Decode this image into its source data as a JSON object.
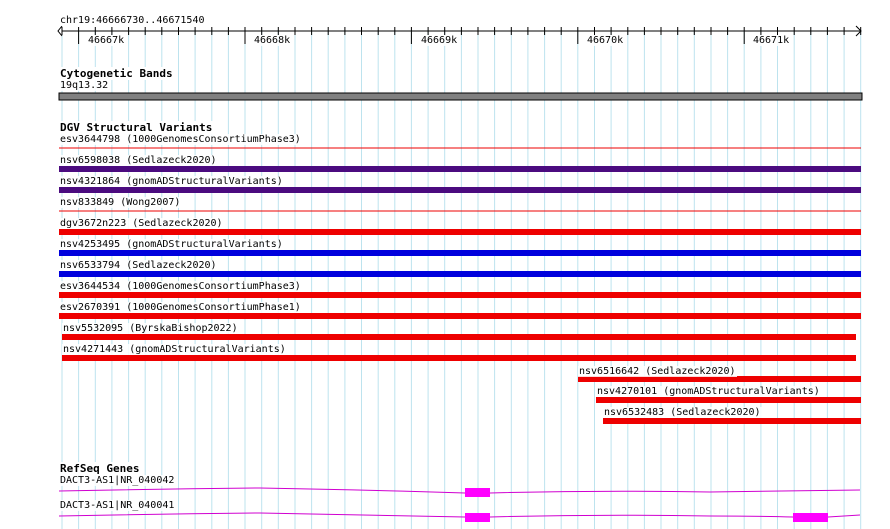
{
  "ruler": {
    "location": "chr19:46666730..46671540",
    "ticks": [
      "46667k",
      "46668k",
      "46669k",
      "46670k",
      "46671k"
    ]
  },
  "cytoband": {
    "title": "Cytogenetic Bands",
    "band": "19q13.32",
    "color": "#808080"
  },
  "dgv": {
    "title": "DGV Structural Variants",
    "colors": {
      "red": "#ee0000",
      "blue": "#0000dd",
      "purple": "#4b0b7f"
    },
    "features": [
      {
        "label": "esv3644798 (1000GenomesConsortiumPhase3)",
        "color": "red",
        "thin": true
      },
      {
        "label": "nsv6598038 (Sedlazeck2020)",
        "color": "purple"
      },
      {
        "label": "nsv4321864 (gnomADStructuralVariants)",
        "color": "purple"
      },
      {
        "label": "nsv833849 (Wong2007)",
        "color": "red",
        "thin": true
      },
      {
        "label": "dgv3672n223 (Sedlazeck2020)",
        "color": "red"
      },
      {
        "label": "nsv4253495 (gnomADStructuralVariants)",
        "color": "blue"
      },
      {
        "label": "nsv6533794 (Sedlazeck2020)",
        "color": "blue"
      },
      {
        "label": "esv3644534 (1000GenomesConsortiumPhase3)",
        "color": "red"
      },
      {
        "label": "esv2670391 (1000GenomesConsortiumPhase1)",
        "color": "red"
      },
      {
        "label": "nsv5532095 (ByrskaBishop2022)",
        "color": "red"
      },
      {
        "label": "nsv4271443 (gnomADStructuralVariants)",
        "color": "red"
      },
      {
        "label": "nsv6516642 (Sedlazeck2020)",
        "color": "red"
      },
      {
        "label": "nsv4270101 (gnomADStructuralVariants)",
        "color": "red"
      },
      {
        "label": "nsv6532483 (Sedlazeck2020)",
        "color": "red"
      }
    ]
  },
  "refseq": {
    "title": "RefSeq Genes",
    "exon_color": "#ff00ff",
    "intron_color": "#d000d0",
    "transcripts": [
      {
        "label": "DACT3-AS1|NR_040042",
        "exons": 1
      },
      {
        "label": "DACT3-AS1|NR_040041",
        "exons": 2
      }
    ]
  }
}
